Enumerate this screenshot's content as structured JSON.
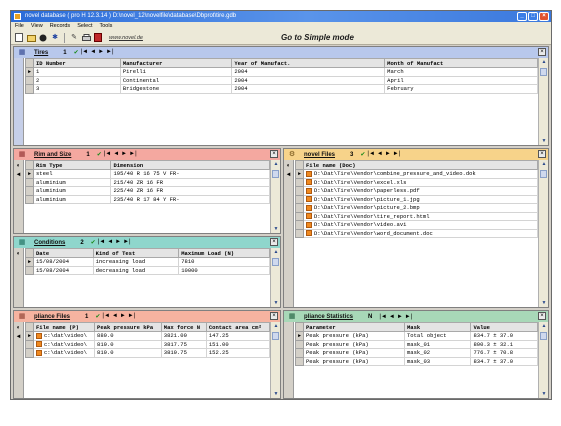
{
  "window": {
    "title": "novel database ( pro H 12.3.14 )   D:\\novel_12\\novelfile\\database\\Dbprot\\tire.gdb",
    "min": "_",
    "max": "□",
    "close": "×"
  },
  "menu": [
    "File",
    "View",
    "Records",
    "Select",
    "Tools"
  ],
  "toolbar": {
    "icons": [
      "new-icon",
      "open-icon",
      "stop-icon",
      "star-icon",
      "wrench-icon",
      "print-icon",
      "exit-icon"
    ],
    "link": "www.novel.de",
    "simple_mode": "Go to Simple mode"
  },
  "nav_glyphs": {
    "check": "✔",
    "first": "|◄",
    "prev": "◄",
    "next": "►",
    "last": "►|"
  },
  "tires": {
    "name": "Tires",
    "count": "1",
    "columns": [
      "ID Number",
      "Manufacturer",
      "Year of Manufact.",
      "Month of Manufact"
    ],
    "rows": [
      [
        "1",
        "Pirelli",
        "2004",
        "March"
      ],
      [
        "2",
        "Continental",
        "2004",
        "April"
      ],
      [
        "3",
        "Bridgestone",
        "2004",
        "February"
      ]
    ]
  },
  "rim": {
    "name": "Rim and Size",
    "count": "1",
    "columns": [
      "Rim Type",
      "Dimension"
    ],
    "rows": [
      [
        "steel",
        "195/40 R 16 75 V FR-"
      ],
      [
        "aluminium",
        "215/40 ZR 16 FR"
      ],
      [
        "aluminium",
        "225/40 ZR 16 FR"
      ],
      [
        "aluminium",
        "235/40 R 17 84 Y FR-"
      ]
    ]
  },
  "conditions": {
    "name": "Conditions",
    "count": "2",
    "columns": [
      "Date",
      "Kind of Test",
      "Maximum Load (N)"
    ],
    "rows": [
      [
        "15/08/2004",
        "increasing load",
        "7810"
      ],
      [
        "15/08/2004",
        "decreasing load",
        "10000"
      ]
    ]
  },
  "files": {
    "name": "novel Files",
    "count": "3",
    "columns": [
      "File name (Doc)"
    ],
    "rows": [
      "D:\\Dat\\Tire\\Vendor\\combine_pressure_and_video.dok",
      "D:\\Dat\\Tire\\Vendor\\excel.xls",
      "D:\\Dat\\Tire\\Vendor\\paperless.pdf",
      "D:\\Dat\\Tire\\Vendor\\picture_1.jpg",
      "D:\\Dat\\Tire\\Vendor\\picture_2.bmp",
      "D:\\Dat\\Tire\\Vendor\\tire_report.html",
      "D:\\Dat\\Tire\\Vendor\\video.avi",
      "D:\\Dat\\Tire\\Vendor\\word_document.doc"
    ]
  },
  "pfiles": {
    "name": "pliance Files",
    "count": "1",
    "columns": [
      "File name (P)",
      "Peak pressure kPa",
      "Max force N",
      "Contact area cm²"
    ],
    "rows": [
      [
        "c:\\dat\\video\\",
        "880.0",
        "3821.00",
        "147.25"
      ],
      [
        "c:\\dat\\video\\",
        "810.0",
        "3817.75",
        "151.00"
      ],
      [
        "c:\\dat\\video\\",
        "810.0",
        "3810.75",
        "152.25"
      ]
    ]
  },
  "stats": {
    "name": "pliance Statistics",
    "count": "N",
    "columns": [
      "Parameter",
      "Mask",
      "Value"
    ],
    "rows": [
      [
        "Peak pressure (kPa)",
        "Total object",
        "834.7 ± 37.0"
      ],
      [
        "Peak pressure (kPa)",
        "mask_01",
        "800.3 ± 32.1"
      ],
      [
        "Peak pressure (kPa)",
        "mask_02",
        "776.7 ± 70.8"
      ],
      [
        "Peak pressure (kPa)",
        "mask_03",
        "834.7 ± 37.0"
      ]
    ]
  }
}
